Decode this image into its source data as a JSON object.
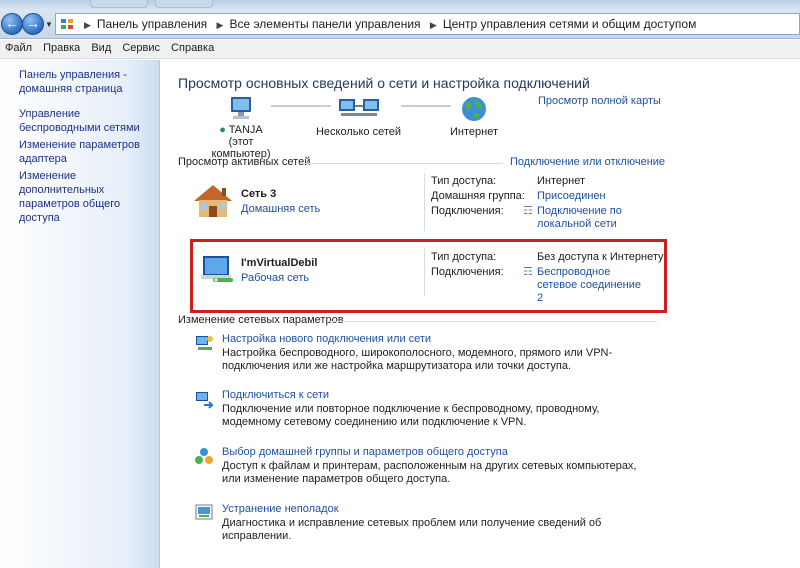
{
  "address_bar": {
    "breadcrumbs": [
      "Панель управления",
      "Все элементы панели управления",
      "Центр управления сетями и общим доступом"
    ]
  },
  "menu": [
    "Файл",
    "Правка",
    "Вид",
    "Сервис",
    "Справка"
  ],
  "sidebar": {
    "items": [
      {
        "label": "Панель управления - домашняя страница"
      },
      {
        "label": "Управление беспроводными сетями"
      },
      {
        "label": "Изменение параметров адаптера"
      },
      {
        "label": "Изменение дополнительных параметров общего доступа"
      }
    ]
  },
  "main": {
    "title": "Просмотр основных сведений о сети и настройка подключений",
    "full_map_link": "Просмотр полной карты",
    "map": {
      "computer": {
        "name": "TANJA",
        "sub": "(этот компьютер)"
      },
      "network": {
        "name": "Несколько сетей"
      },
      "internet": {
        "name": "Интернет"
      }
    },
    "active_networks_header": "Просмотр активных сетей",
    "connect_disconnect_link": "Подключение или отключение",
    "networks": [
      {
        "name": "Сеть  3",
        "type": "Домашняя сеть",
        "access_label": "Тип доступа:",
        "access_value": "Интернет",
        "homegroup_label": "Домашняя группа:",
        "homegroup_value": "Присоединен",
        "connections_label": "Подключения:",
        "connections_value": "Подключение по локальной сети"
      },
      {
        "name": "I'mVirtualDebil",
        "type": "Рабочая сеть",
        "access_label": "Тип доступа:",
        "access_value": "Без доступа к Интернету",
        "connections_label": "Подключения:",
        "connections_value": "Беспроводное сетевое соединение 2"
      }
    ],
    "change_settings_header": "Изменение сетевых параметров",
    "tasks": [
      {
        "link": "Настройка нового подключения или сети",
        "desc": "Настройка беспроводного, широкополосного, модемного, прямого или VPN-подключения или же настройка маршрутизатора или точки доступа."
      },
      {
        "link": "Подключиться к сети",
        "desc": "Подключение или повторное подключение к беспроводному, проводному, модемному сетевому соединению или подключение к VPN."
      },
      {
        "link": "Выбор домашней группы и параметров общего доступа",
        "desc": "Доступ к файлам и принтерам, расположенным на других сетевых компьютерах, или изменение параметров общего доступа."
      },
      {
        "link": "Устранение неполадок",
        "desc": "Диагностика и исправление сетевых проблем или получение сведений об исправлении."
      }
    ]
  },
  "colors": {
    "link": "#1e50a2",
    "highlight_border": "#cc1f1f"
  }
}
